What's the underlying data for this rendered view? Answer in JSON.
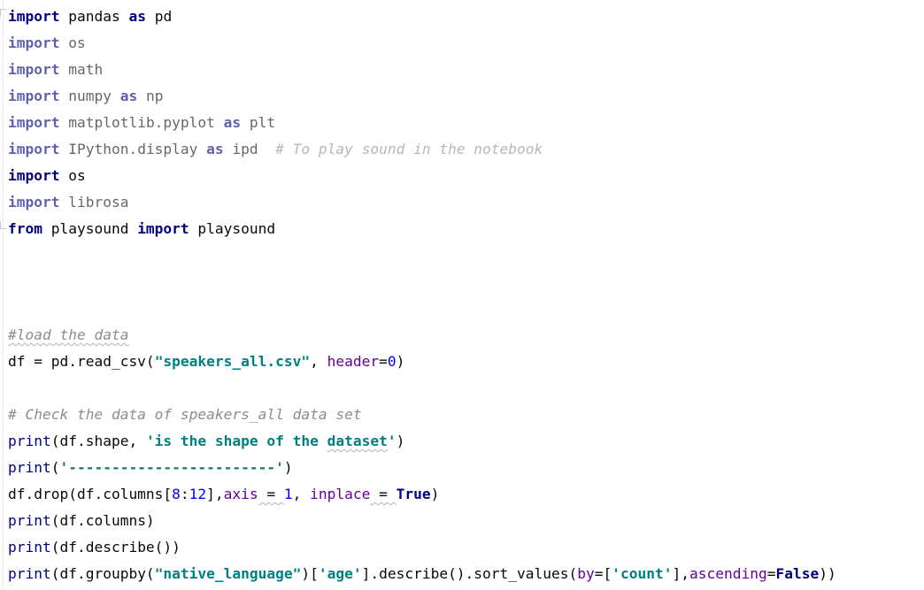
{
  "editor": {
    "lines": [
      {
        "tokens": [
          {
            "t": "import",
            "c": "kw"
          },
          {
            "t": " pandas ",
            "c": "plain"
          },
          {
            "t": "as",
            "c": "kw"
          },
          {
            "t": " pd",
            "c": "plain"
          }
        ],
        "dim": false
      },
      {
        "tokens": [
          {
            "t": "import",
            "c": "kw"
          },
          {
            "t": " os",
            "c": "plain"
          }
        ],
        "dim": true
      },
      {
        "tokens": [
          {
            "t": "import",
            "c": "kw"
          },
          {
            "t": " math",
            "c": "plain"
          }
        ],
        "dim": true
      },
      {
        "tokens": [
          {
            "t": "import",
            "c": "kw"
          },
          {
            "t": " numpy ",
            "c": "plain"
          },
          {
            "t": "as",
            "c": "kw"
          },
          {
            "t": " np",
            "c": "plain"
          }
        ],
        "dim": true
      },
      {
        "tokens": [
          {
            "t": "import",
            "c": "kw"
          },
          {
            "t": " matplotlib.pyplot ",
            "c": "plain"
          },
          {
            "t": "as",
            "c": "kw"
          },
          {
            "t": " plt",
            "c": "plain"
          }
        ],
        "dim": true
      },
      {
        "tokens": [
          {
            "t": "import",
            "c": "kw"
          },
          {
            "t": " IPython.display ",
            "c": "plain"
          },
          {
            "t": "as",
            "c": "kw"
          },
          {
            "t": " ipd  ",
            "c": "plain"
          },
          {
            "t": "# To play sound in the notebook",
            "c": "com"
          }
        ],
        "dim": true
      },
      {
        "tokens": [
          {
            "t": "import",
            "c": "kw"
          },
          {
            "t": " os",
            "c": "plain"
          }
        ],
        "dim": false
      },
      {
        "tokens": [
          {
            "t": "import",
            "c": "kw"
          },
          {
            "t": " librosa",
            "c": "plain"
          }
        ],
        "dim": true
      },
      {
        "tokens": [
          {
            "t": "from",
            "c": "kw"
          },
          {
            "t": " playsound ",
            "c": "plain"
          },
          {
            "t": "import",
            "c": "kw"
          },
          {
            "t": " playsound",
            "c": "plain"
          }
        ],
        "dim": false
      },
      {
        "tokens": [],
        "dim": false
      },
      {
        "tokens": [],
        "dim": false
      },
      {
        "tokens": [],
        "dim": false
      },
      {
        "tokens": [
          {
            "t": "#load the data",
            "c": "com squiggle"
          }
        ],
        "dim": false
      },
      {
        "tokens": [
          {
            "t": "df = pd.read_csv(",
            "c": "plain"
          },
          {
            "t": "\"speakers_all.csv\"",
            "c": "str-teal"
          },
          {
            "t": ", ",
            "c": "plain"
          },
          {
            "t": "header",
            "c": "param"
          },
          {
            "t": "=",
            "c": "plain"
          },
          {
            "t": "0",
            "c": "num"
          },
          {
            "t": ")",
            "c": "plain"
          }
        ],
        "dim": false
      },
      {
        "tokens": [],
        "dim": false
      },
      {
        "tokens": [
          {
            "t": "# Check the data of speakers_all data set",
            "c": "com"
          }
        ],
        "dim": false
      },
      {
        "tokens": [
          {
            "t": "print",
            "c": "builtin"
          },
          {
            "t": "(df.shape, ",
            "c": "plain"
          },
          {
            "t": "'is the shape of the ",
            "c": "str-teal"
          },
          {
            "t": "dataset",
            "c": "str-teal squiggle"
          },
          {
            "t": "'",
            "c": "str-teal"
          },
          {
            "t": ")",
            "c": "plain"
          }
        ],
        "dim": false
      },
      {
        "tokens": [
          {
            "t": "print",
            "c": "builtin"
          },
          {
            "t": "(",
            "c": "plain"
          },
          {
            "t": "'------------------------'",
            "c": "str-teal"
          },
          {
            "t": ")",
            "c": "plain"
          }
        ],
        "dim": false
      },
      {
        "tokens": [
          {
            "t": "df.drop(df.columns[",
            "c": "plain"
          },
          {
            "t": "8",
            "c": "num"
          },
          {
            "t": ":",
            "c": "plain"
          },
          {
            "t": "12",
            "c": "num"
          },
          {
            "t": "],",
            "c": "plain"
          },
          {
            "t": "axis",
            "c": "param"
          },
          {
            "t": " = ",
            "c": "plain squiggle"
          },
          {
            "t": "1",
            "c": "num"
          },
          {
            "t": ", ",
            "c": "plain"
          },
          {
            "t": "inplace",
            "c": "param"
          },
          {
            "t": " = ",
            "c": "plain squiggle"
          },
          {
            "t": "True",
            "c": "tru"
          },
          {
            "t": ")",
            "c": "plain"
          }
        ],
        "dim": false
      },
      {
        "tokens": [
          {
            "t": "print",
            "c": "builtin"
          },
          {
            "t": "(df.columns)",
            "c": "plain"
          }
        ],
        "dim": false
      },
      {
        "tokens": [
          {
            "t": "print",
            "c": "builtin"
          },
          {
            "t": "(df.describe())",
            "c": "plain"
          }
        ],
        "dim": false
      },
      {
        "tokens": [
          {
            "t": "print",
            "c": "builtin"
          },
          {
            "t": "(df.groupby(",
            "c": "plain"
          },
          {
            "t": "\"native_language\"",
            "c": "str-teal"
          },
          {
            "t": ")[",
            "c": "plain"
          },
          {
            "t": "'age'",
            "c": "str-teal"
          },
          {
            "t": "].describe().sort_values(",
            "c": "plain"
          },
          {
            "t": "by",
            "c": "param"
          },
          {
            "t": "=[",
            "c": "plain"
          },
          {
            "t": "'count'",
            "c": "str-teal"
          },
          {
            "t": "],",
            "c": "plain"
          },
          {
            "t": "ascending",
            "c": "param"
          },
          {
            "t": "=",
            "c": "plain"
          },
          {
            "t": "False",
            "c": "tru"
          },
          {
            "t": "))",
            "c": "plain"
          }
        ],
        "dim": false
      }
    ]
  }
}
